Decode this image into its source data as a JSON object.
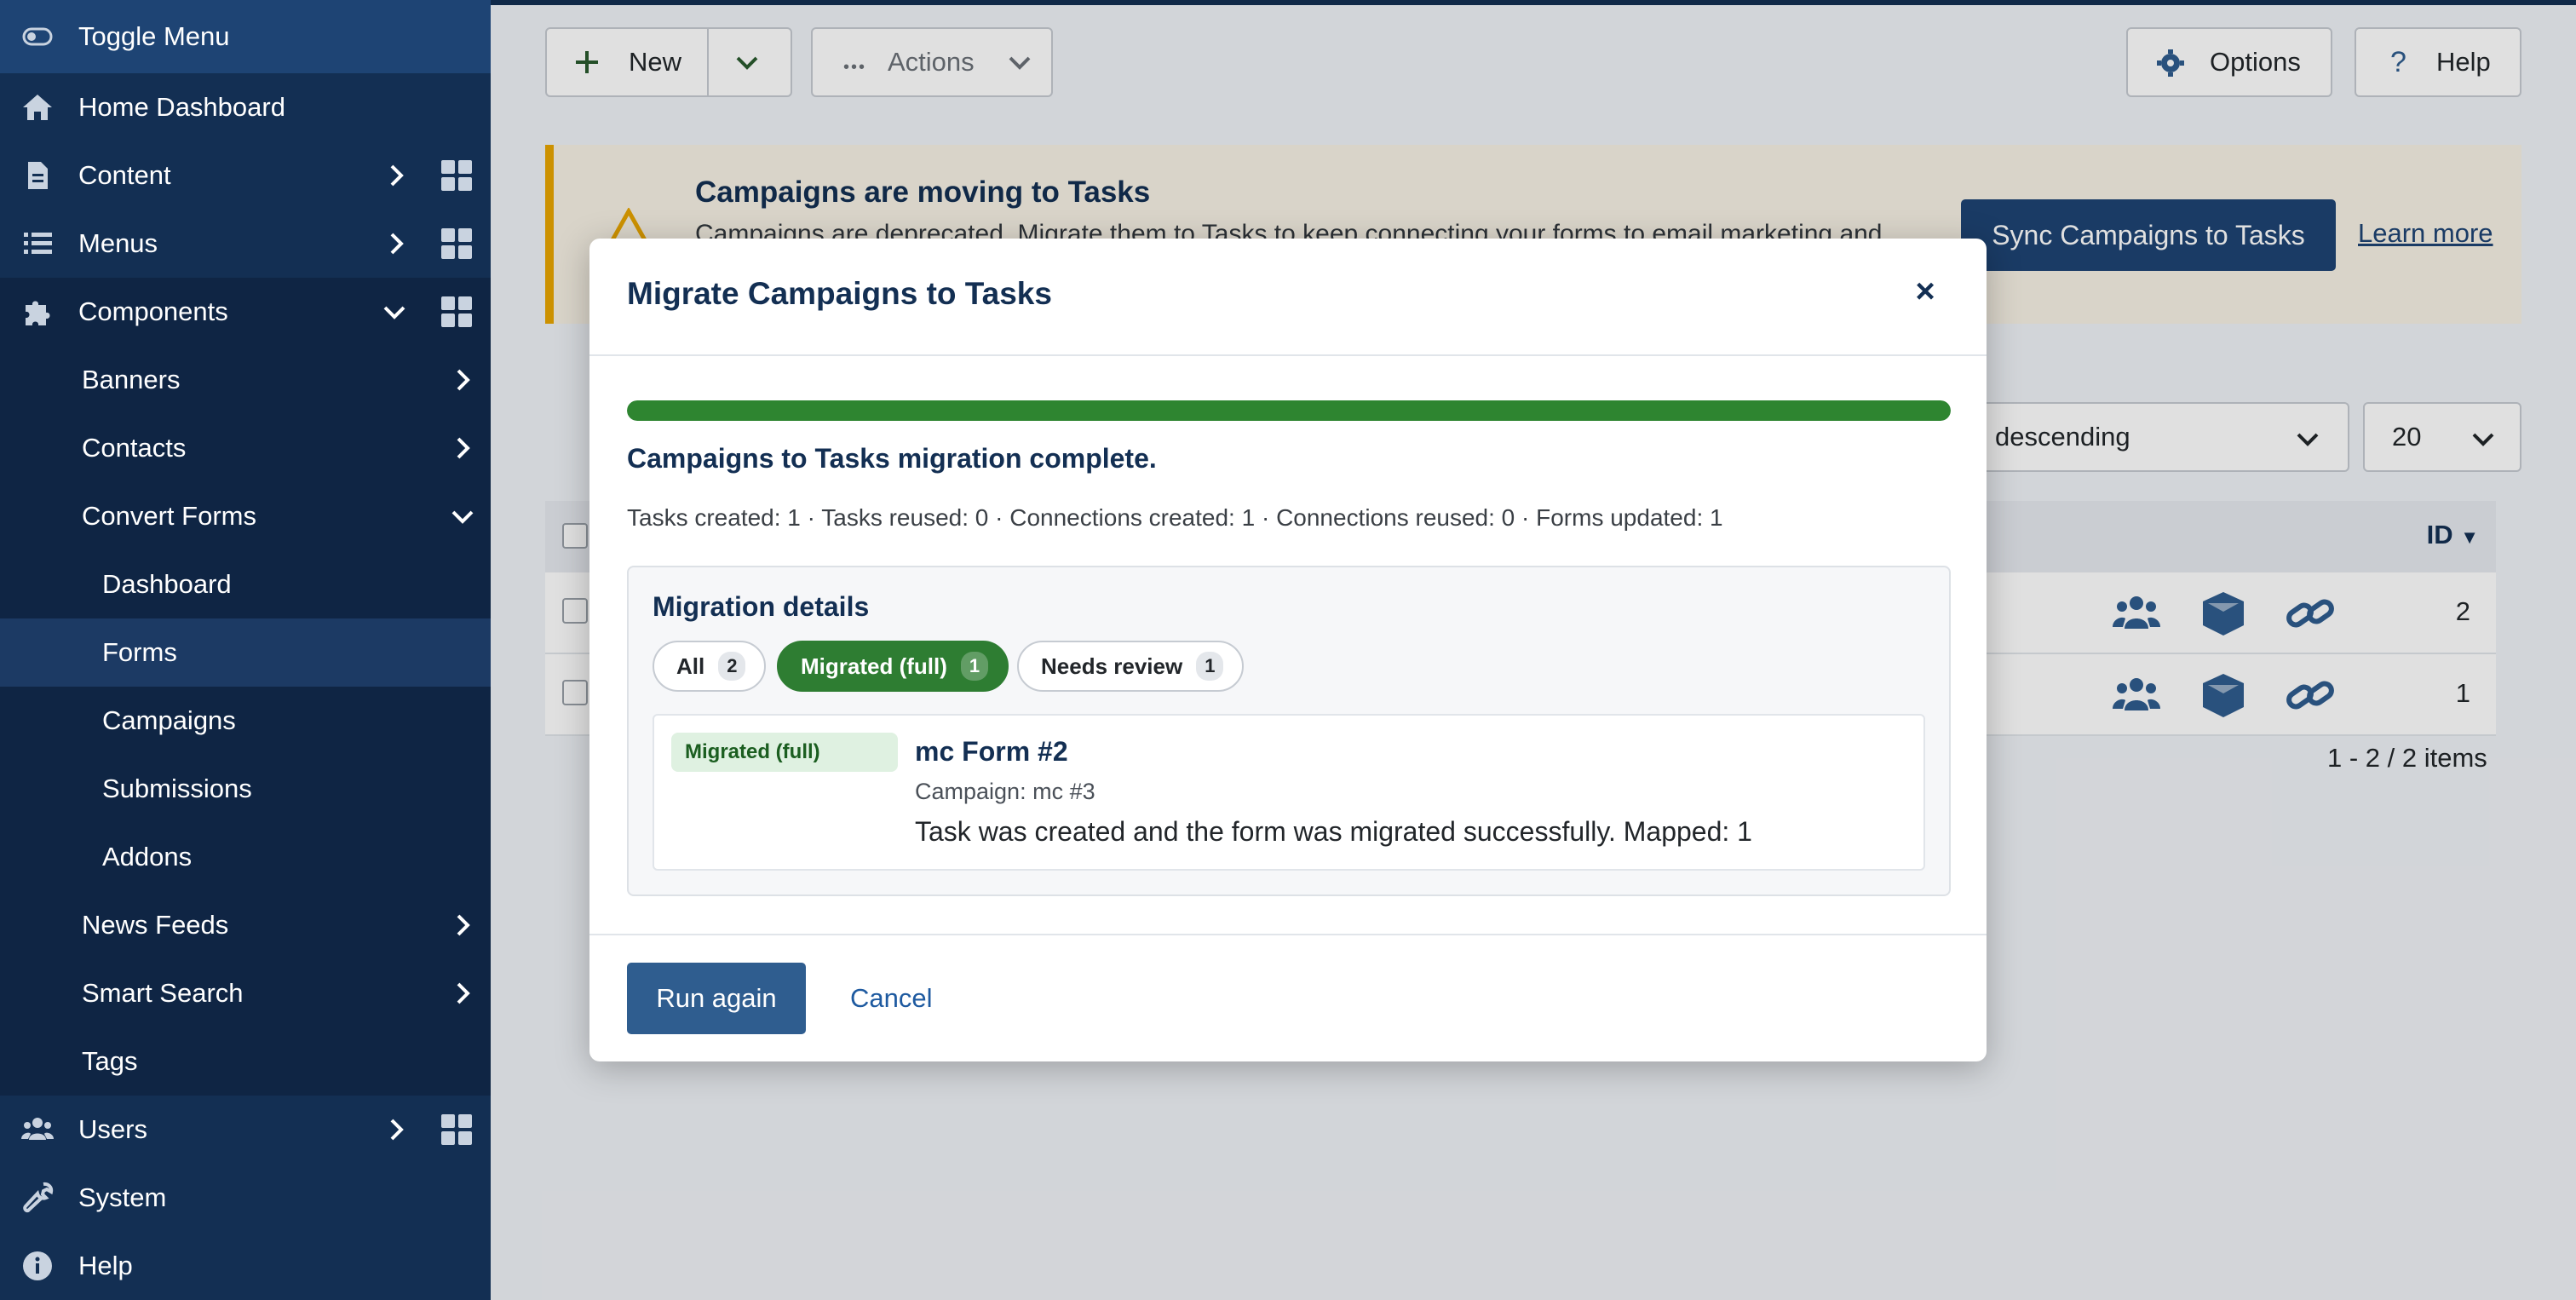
{
  "sidebar": {
    "toggle_label": "Toggle Menu",
    "items": [
      {
        "label": "Home Dashboard"
      },
      {
        "label": "Content"
      },
      {
        "label": "Menus"
      },
      {
        "label": "Components"
      },
      {
        "label": "Banners"
      },
      {
        "label": "Contacts"
      },
      {
        "label": "Convert Forms"
      },
      {
        "label": "Dashboard"
      },
      {
        "label": "Forms"
      },
      {
        "label": "Campaigns"
      },
      {
        "label": "Submissions"
      },
      {
        "label": "Addons"
      },
      {
        "label": "News Feeds"
      },
      {
        "label": "Smart Search"
      },
      {
        "label": "Tags"
      },
      {
        "label": "Users"
      },
      {
        "label": "System"
      },
      {
        "label": "Help"
      }
    ],
    "active_item": "Forms"
  },
  "toolbar": {
    "new_label": "New",
    "actions_label": "Actions",
    "options_label": "Options",
    "help_label": "Help"
  },
  "banner": {
    "title": "Campaigns are moving to Tasks",
    "text": "Campaigns are deprecated. Migrate them to Tasks to keep connecting your forms to email marketing and",
    "button_label": "Sync Campaigns to Tasks",
    "link_label": "Learn more",
    "accent_color": "#e9a600"
  },
  "list": {
    "ordering_value": "descending",
    "limit_value": "20",
    "id_header": "ID",
    "rows": [
      {
        "id": "2"
      },
      {
        "id": "1"
      }
    ],
    "pagination_text": "1 - 2 / 2 items"
  },
  "modal": {
    "title": "Migrate Campaigns to Tasks",
    "close_label": "×",
    "progress_percent": 100,
    "progress_color": "#2e8530",
    "complete_message": "Campaigns to Tasks migration complete.",
    "stats": "Tasks created: 1 · Tasks reused: 0 · Connections created: 1 · Connections reused: 0 · Forms updated: 1",
    "details": {
      "title": "Migration details",
      "filters": [
        {
          "label": "All",
          "count": "2",
          "active": false
        },
        {
          "label": "Migrated (full)",
          "count": "1",
          "active": true
        },
        {
          "label": "Needs review",
          "count": "1",
          "active": false
        }
      ],
      "items": [
        {
          "status": "Migrated (full)",
          "name": "mc Form #2",
          "campaign": "Campaign: mc #3",
          "message": "Task was created and the form was migrated successfully. Mapped: 1"
        }
      ]
    },
    "run_again_label": "Run again",
    "cancel_label": "Cancel"
  }
}
